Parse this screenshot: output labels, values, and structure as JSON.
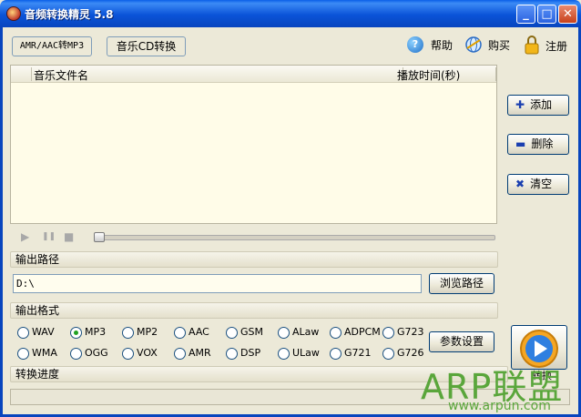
{
  "window": {
    "title": "音频转换精灵 5.8",
    "minimize": "_",
    "maximize": "□",
    "close": "✕"
  },
  "toolbar": {
    "amr_button": "AMR/AAC转MP3",
    "cd_button": "音乐CD转换",
    "help_label": "帮助",
    "buy_label": "购买",
    "register_label": "注册"
  },
  "file_list": {
    "col_name": "音乐文件名",
    "col_duration": "播放时间(秒)"
  },
  "side_buttons": {
    "add": "添加",
    "delete": "删除",
    "clear": "清空"
  },
  "player": {
    "play": "▶",
    "pause": "❚❚",
    "stop": "■",
    "progress": 0
  },
  "output_path": {
    "section_label": "输出路径",
    "value": "D:\\",
    "browse_button": "浏览路径"
  },
  "output_format": {
    "section_label": "输出格式",
    "selected": "MP3",
    "row1": [
      "WAV",
      "MP3",
      "MP2",
      "AAC",
      "GSM",
      "ALaw",
      "ADPCM",
      "G723"
    ],
    "row2": [
      "WMA",
      "OGG",
      "VOX",
      "AMR",
      "DSP",
      "ULaw",
      "G721",
      "G726"
    ],
    "params_button": "参数设置"
  },
  "conversion": {
    "section_label": "转换进度",
    "convert_label": "转换",
    "progress": 0
  },
  "watermark": {
    "brand": "ARP联盟",
    "url": "www.arpun.com"
  },
  "colors": {
    "titlebar": "#0A53D8",
    "list_bg": "#FFFCE8",
    "window_bg": "#ECE9D8",
    "watermark": "#5AA63B"
  }
}
